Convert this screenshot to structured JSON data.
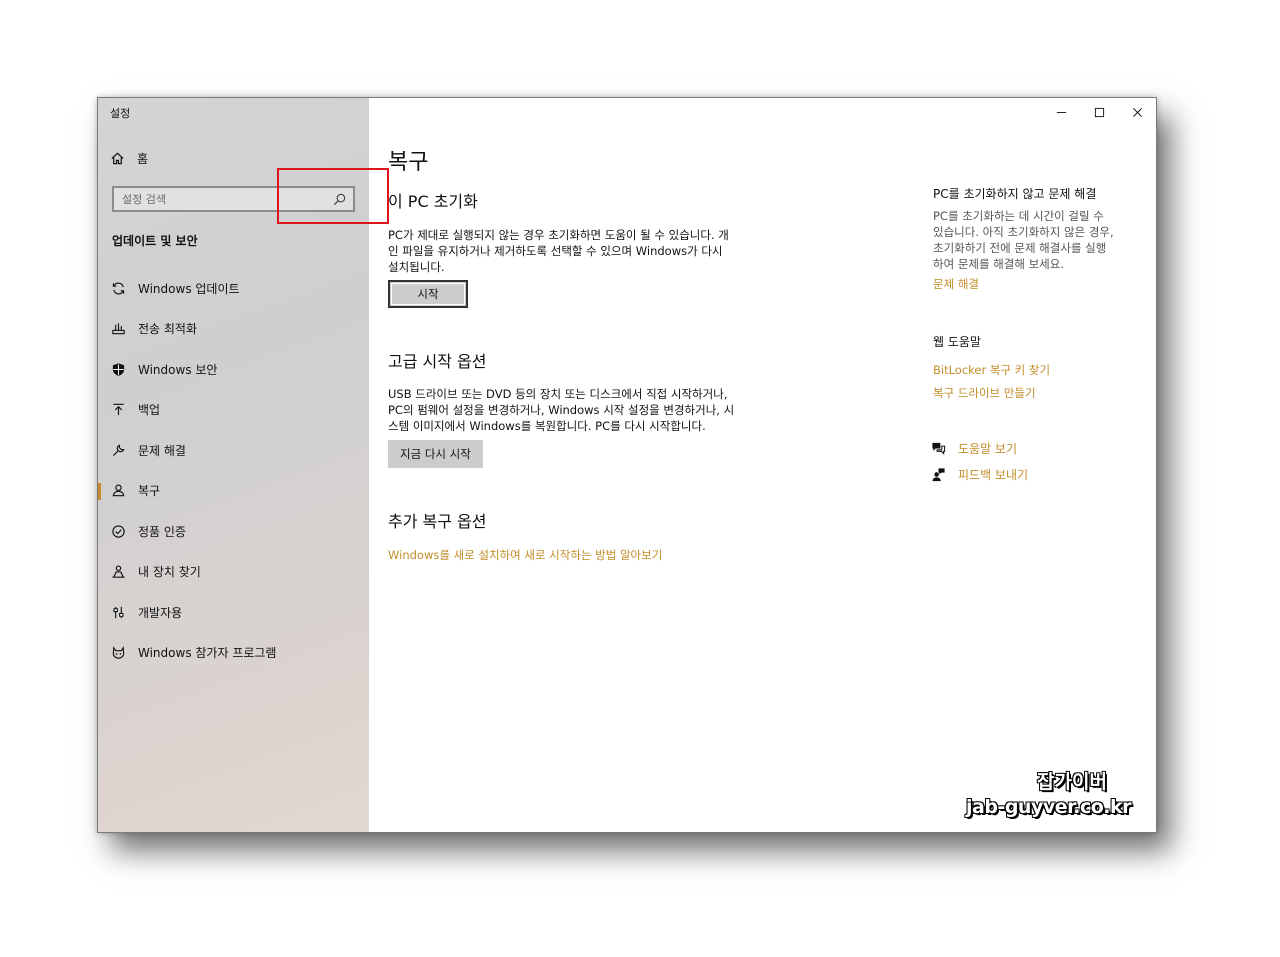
{
  "window": {
    "title": "설정"
  },
  "sidebar": {
    "home_label": "홈",
    "search_placeholder": "설정 검색",
    "section_title": "업데이트 및 보안",
    "items": [
      {
        "label": "Windows 업데이트",
        "icon": "sync-icon"
      },
      {
        "label": "전송 최적화",
        "icon": "delivery-optimization-icon"
      },
      {
        "label": "Windows 보안",
        "icon": "shield-icon"
      },
      {
        "label": "백업",
        "icon": "backup-arrow-icon"
      },
      {
        "label": "문제 해결",
        "icon": "wrench-icon"
      },
      {
        "label": "복구",
        "icon": "recovery-person-icon",
        "active": true
      },
      {
        "label": "정품 인증",
        "icon": "check-circle-icon"
      },
      {
        "label": "내 장치 찾기",
        "icon": "find-device-icon"
      },
      {
        "label": "개발자용",
        "icon": "developer-sliders-icon"
      },
      {
        "label": "Windows 참가자 프로그램",
        "icon": "insider-cat-icon"
      }
    ]
  },
  "main": {
    "title": "복구",
    "reset": {
      "heading": "이 PC 초기화",
      "desc_lines": [
        "PC가 제대로 실행되지 않는 경우 초기화하면 도움이 될 수 있습니다. 개",
        "인 파일을 유지하거나 제거하도록 선택할 수 있으며 Windows가 다시",
        "설치됩니다."
      ],
      "button": "시작"
    },
    "advanced": {
      "heading": "고급 시작 옵션",
      "desc_lines": [
        "USB 드라이브 또는 DVD 등의 장치 또는 디스크에서 직접 시작하거나,",
        "PC의 펌웨어 설정을 변경하거나, Windows 시작 설정을 변경하거나, 시",
        "스템 이미지에서 Windows를 복원합니다. PC를 다시 시작합니다."
      ],
      "button": "지금 다시 시작"
    },
    "more": {
      "heading": "추가 복구 옵션",
      "link": "Windows를 새로 설치하여 새로 시작하는 방법 알아보기"
    }
  },
  "right": {
    "troubleshoot": {
      "heading": "PC를 초기화하지 않고 문제 해결",
      "desc_lines": [
        "PC를 초기화하는 데 시간이 걸릴 수",
        "있습니다. 아직 초기화하지 않은 경우,",
        "초기화하기 전에 문제 해결사를 실행",
        "하여 문제를 해결해 보세요."
      ],
      "link": "문제 해결"
    },
    "web_help": {
      "heading": "웹 도움말",
      "links": [
        "BitLocker 복구 키 찾기",
        "복구 드라이브 만들기"
      ]
    },
    "help_actions": [
      {
        "label": "도움말 보기",
        "icon": "help-chat-icon"
      },
      {
        "label": "피드백 보내기",
        "icon": "feedback-person-icon"
      }
    ]
  },
  "watermark": {
    "line1": "잡가이버",
    "line2": "jab-guyver.co.kr"
  },
  "colors": {
    "accent_link": "#c28d2a",
    "active_indicator": "#c78b2b",
    "highlight_box": "#e1141e",
    "button_bg": "#cccccc"
  }
}
